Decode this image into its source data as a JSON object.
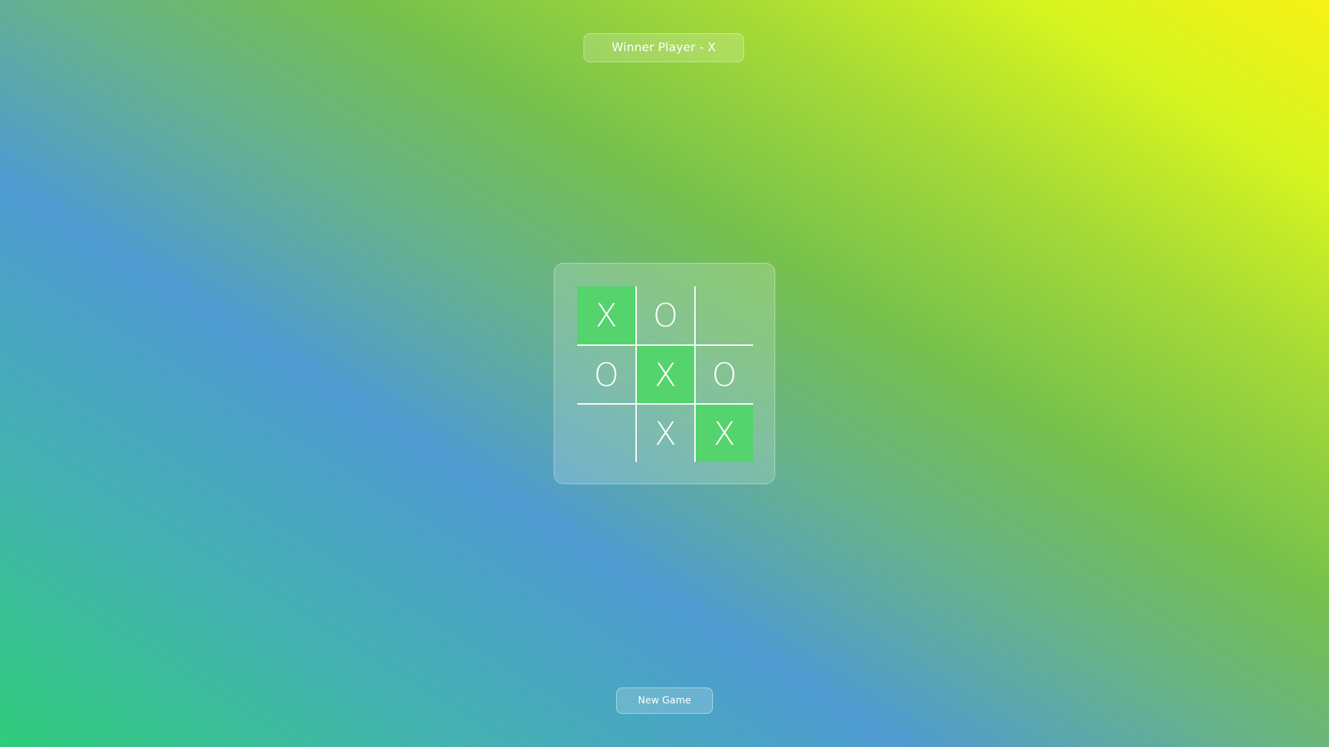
{
  "status": {
    "text": "Winner Player - X"
  },
  "board": {
    "cells": [
      {
        "value": "X",
        "winning": true
      },
      {
        "value": "O",
        "winning": false
      },
      {
        "value": "",
        "winning": false
      },
      {
        "value": "O",
        "winning": false
      },
      {
        "value": "X",
        "winning": true
      },
      {
        "value": "O",
        "winning": false
      },
      {
        "value": "",
        "winning": false
      },
      {
        "value": "X",
        "winning": false
      },
      {
        "value": "X",
        "winning": true
      }
    ],
    "winning_color": "#55d36d"
  },
  "controls": {
    "new_game_label": "New Game"
  }
}
